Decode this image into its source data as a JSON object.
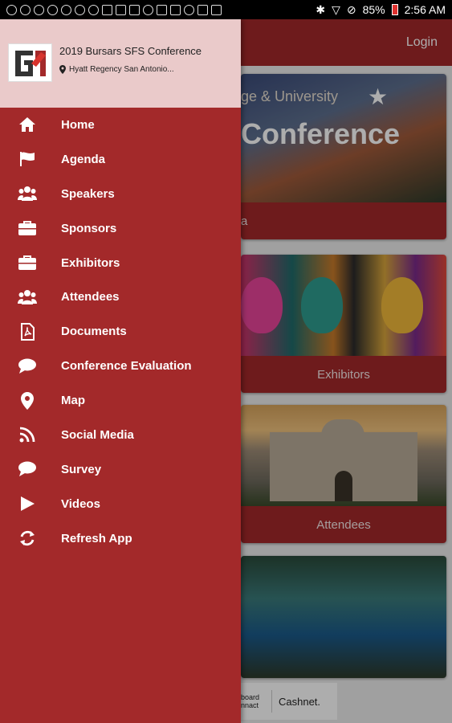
{
  "status_bar": {
    "battery": "85%",
    "time": "2:56 AM"
  },
  "app": {
    "header": {
      "login_label": "Login"
    },
    "tiles": [
      {
        "caption": "a",
        "banner_subtitle": "ge & University",
        "banner_title": "Conference"
      },
      {
        "caption": "Exhibitors"
      },
      {
        "caption": "Attendees"
      },
      {
        "caption": ""
      }
    ],
    "sponsors": {
      "sponsor_1": "board\nnnact",
      "sponsor_2": "Cashnet."
    }
  },
  "drawer": {
    "event_name": "2019 Bursars SFS Conference",
    "venue": "Hyatt Regency San Antonio...",
    "menu": [
      {
        "label": "Home",
        "icon": "home-icon"
      },
      {
        "label": "Agenda",
        "icon": "flag-icon"
      },
      {
        "label": "Speakers",
        "icon": "people-icon"
      },
      {
        "label": "Sponsors",
        "icon": "briefcase-icon"
      },
      {
        "label": "Exhibitors",
        "icon": "briefcase-icon"
      },
      {
        "label": "Attendees",
        "icon": "people-icon"
      },
      {
        "label": "Documents",
        "icon": "pdf-icon"
      },
      {
        "label": "Conference Evaluation",
        "icon": "chat-bubble-icon"
      },
      {
        "label": "Map",
        "icon": "map-pin-icon"
      },
      {
        "label": "Social Media",
        "icon": "rss-icon"
      },
      {
        "label": "Survey",
        "icon": "chat-bubble-icon"
      },
      {
        "label": "Videos",
        "icon": "play-icon"
      },
      {
        "label": "Refresh App",
        "icon": "refresh-icon"
      }
    ]
  },
  "colors": {
    "accent": "#a3292a",
    "drawer_header": "#eacaca"
  }
}
